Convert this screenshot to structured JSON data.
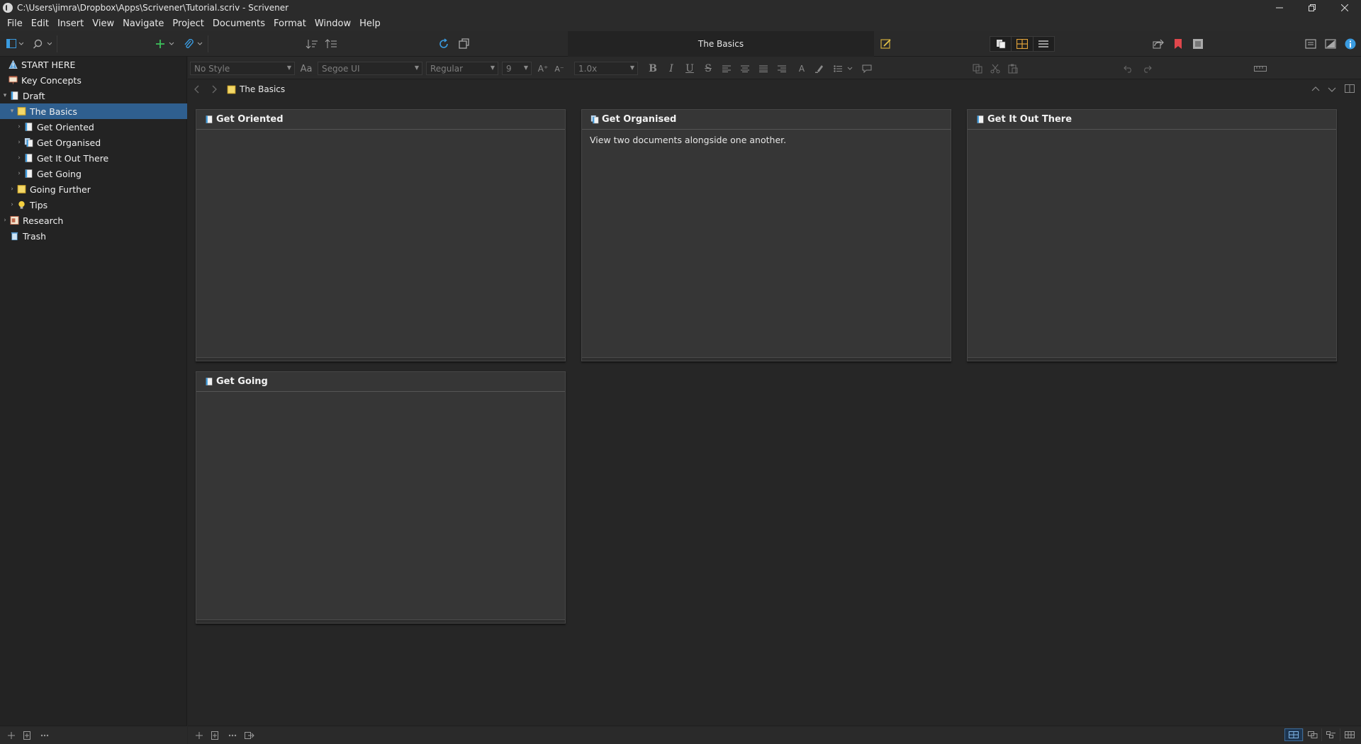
{
  "window": {
    "title": "C:\\Users\\jimra\\Dropbox\\Apps\\Scrivener\\Tutorial.scriv - Scrivener",
    "controls": [
      "minimize",
      "restore",
      "close"
    ]
  },
  "menu": [
    "File",
    "Edit",
    "Insert",
    "View",
    "Navigate",
    "Project",
    "Documents",
    "Format",
    "Window",
    "Help"
  ],
  "toolbar": {
    "document_title": "The Basics"
  },
  "binder": {
    "items": [
      {
        "label": "START HERE",
        "icon": "warning-icon",
        "level": 0,
        "disclosure": ""
      },
      {
        "label": "Key Concepts",
        "icon": "presentation-icon",
        "level": 0,
        "disclosure": ""
      },
      {
        "label": "Draft",
        "icon": "draft-icon",
        "level": 0,
        "disclosure": "▾"
      },
      {
        "label": "The Basics",
        "icon": "folder-icon",
        "level": 1,
        "disclosure": "▾",
        "selected": true
      },
      {
        "label": "Get Oriented",
        "icon": "document-icon",
        "level": 2,
        "disclosure": "›"
      },
      {
        "label": "Get Organised",
        "icon": "document-stack-icon",
        "level": 2,
        "disclosure": "›"
      },
      {
        "label": "Get It Out There",
        "icon": "document-icon",
        "level": 2,
        "disclosure": "›"
      },
      {
        "label": "Get Going",
        "icon": "document-icon",
        "level": 2,
        "disclosure": "›"
      },
      {
        "label": "Going Further",
        "icon": "folder-icon",
        "level": 1,
        "disclosure": "›"
      },
      {
        "label": "Tips",
        "icon": "lightbulb-icon",
        "level": 1,
        "disclosure": "›"
      },
      {
        "label": "Research",
        "icon": "research-icon",
        "level": 0,
        "disclosure": "›"
      },
      {
        "label": "Trash",
        "icon": "trash-icon",
        "level": 0,
        "disclosure": ""
      }
    ]
  },
  "formatbar": {
    "style": "No Style",
    "font": "Segoe UI",
    "weight": "Regular",
    "size": "9",
    "line_spacing": "1.0x",
    "font_glyph": "Aa"
  },
  "header": {
    "breadcrumb": "The Basics"
  },
  "corkboard": {
    "cards": [
      {
        "title": "Get Oriented",
        "synopsis": ""
      },
      {
        "title": "Get Organised",
        "synopsis": "View two documents alongside one another."
      },
      {
        "title": "Get It Out There",
        "synopsis": ""
      },
      {
        "title": "Get Going",
        "synopsis": ""
      }
    ]
  },
  "colors": {
    "selection": "#2f5f8f",
    "accent_green": "#3cc05a",
    "accent_blue": "#3a9be0",
    "bookmark_red": "#e0474c"
  }
}
